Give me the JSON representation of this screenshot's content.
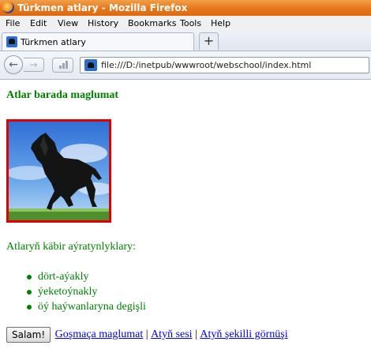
{
  "window": {
    "title": "Türkmen atlary - Mozilla Firefox"
  },
  "menu": [
    "File",
    "Edit",
    "View",
    "History",
    "Bookmarks",
    "Tools",
    "Help"
  ],
  "tab": {
    "title": "Türkmen atlary",
    "new_tab_label": "+"
  },
  "navigation": {
    "url": "file:///D:/inetpub/wwwroot/webschool/index.html"
  },
  "page": {
    "heading": "Atlar barada maglumat",
    "image_icon": "horse-photo",
    "features_label": "Atlaryň käbir aýratynlyklary:",
    "features": [
      "dört-aýakly",
      "ýeketoýnakly",
      "öý haýwanlaryna degişli"
    ],
    "button_label": "Salam!",
    "links": [
      "Goşmaça maglumat",
      "Atyň sesi",
      "Atyň şekilli görnüşi"
    ],
    "separator": "|"
  },
  "colors": {
    "text": "#008000",
    "image_border": "#e00000",
    "link": "#0000ee",
    "titlebar": "#e8761b"
  }
}
